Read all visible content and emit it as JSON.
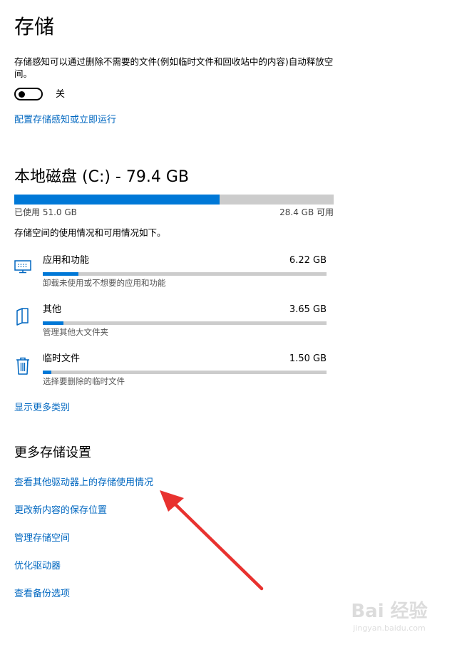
{
  "page": {
    "title": "存储"
  },
  "storage_sense": {
    "description": "存储感知可以通过删除不需要的文件(例如临时文件和回收站中的内容)自动释放空间。",
    "toggle_state": "关",
    "configure_link": "配置存储感知或立即运行"
  },
  "drive": {
    "title": "本地磁盘 (C:) - 79.4 GB",
    "used_label": "已使用 51.0 GB",
    "free_label": "28.4 GB 可用",
    "used_fraction": 0.642,
    "summary": "存储空间的使用情况和可用情况如下。"
  },
  "categories": [
    {
      "name": "应用和功能",
      "size": "6.22 GB",
      "desc": "卸载未使用或不想要的应用和功能",
      "fraction": 0.125,
      "icon": "monitor-icon"
    },
    {
      "name": "其他",
      "size": "3.65 GB",
      "desc": "管理其他大文件夹",
      "fraction": 0.072,
      "icon": "folder-icon"
    },
    {
      "name": "临时文件",
      "size": "1.50 GB",
      "desc": "选择要删除的临时文件",
      "fraction": 0.03,
      "icon": "trash-icon"
    }
  ],
  "show_more_link": "显示更多类别",
  "more_settings": {
    "title": "更多存储设置",
    "links": [
      "查看其他驱动器上的存储使用情况",
      "更改新内容的保存位置",
      "管理存储空间",
      "优化驱动器",
      "查看备份选项"
    ]
  },
  "colors": {
    "accent": "#0078d7",
    "link": "#0067c0",
    "bar_track": "#cccccc",
    "annotation_arrow": "#e8322f"
  },
  "watermark": {
    "text": "Bai 经验",
    "subtext": "jingyan.baidu.com"
  }
}
